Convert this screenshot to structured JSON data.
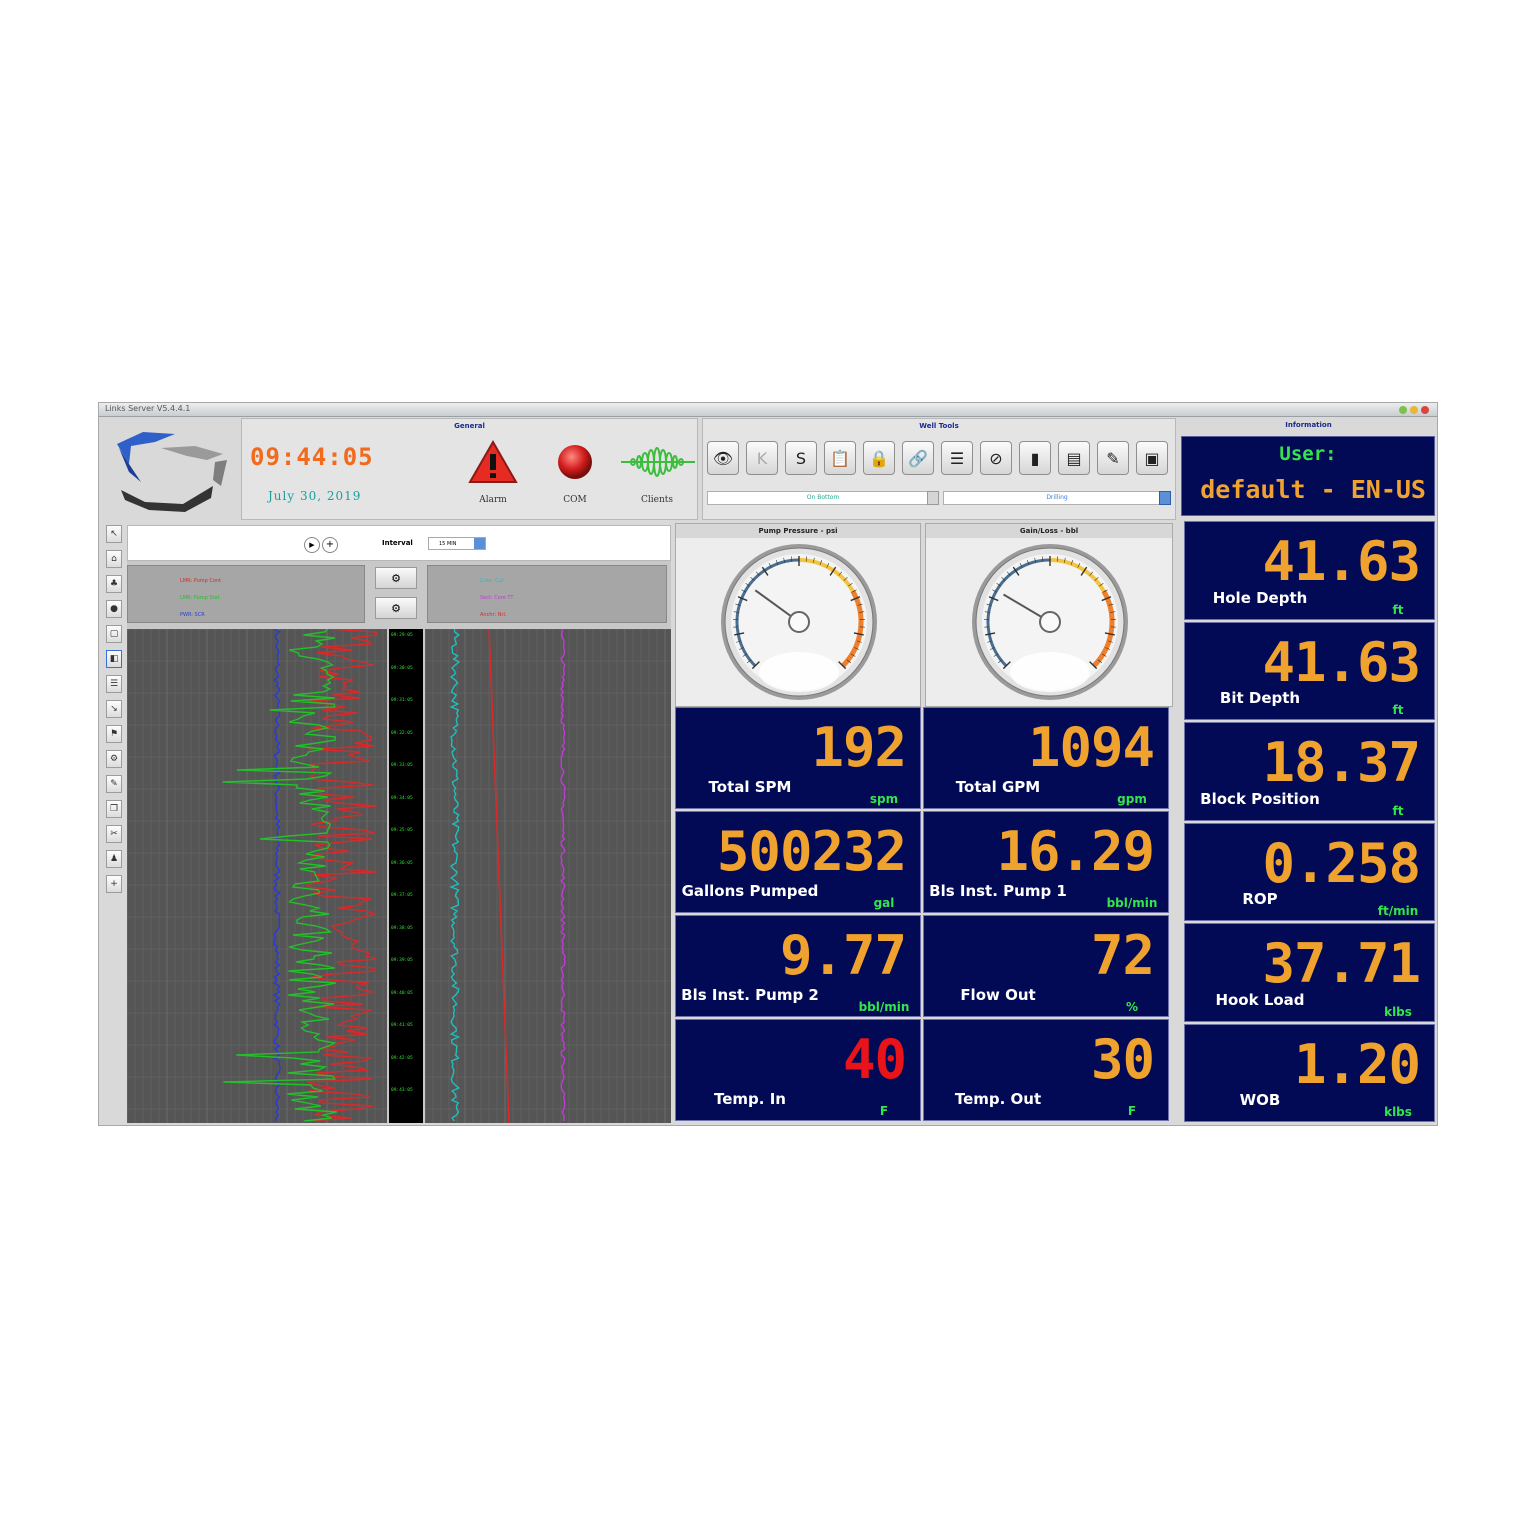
{
  "window": {
    "title": "Links Server V5.4.4.1"
  },
  "general": {
    "section_title": "General",
    "clock": "09:44:05",
    "date": "July 30, 2019",
    "alarm_label": "Alarm",
    "com_label": "COM",
    "clients_label": "Clients"
  },
  "well_tools": {
    "section_title": "Well Tools",
    "buttons": [
      "eye-icon",
      "k-icon",
      "s-icon",
      "clipboard-icon",
      "lock-icon",
      "link-icon",
      "list-icon",
      "compass-icon",
      "tablet-icon",
      "panel-icon",
      "edit-icon",
      "box-icon"
    ],
    "rig_state": "On Bottom",
    "activity": "Drilling"
  },
  "information": {
    "section_title": "Information",
    "user_label": "User:",
    "user_value": "default - EN-US"
  },
  "chart_controls": {
    "interval_label": "Interval",
    "interval_value": "15 MIN"
  },
  "legend_left": [
    {
      "name": "LMR: Pump Cont.",
      "color": "#d82a2a"
    },
    {
      "name": "LMR: Pump Stat.",
      "color": "#22c12a"
    },
    {
      "name": "PWR: SCR",
      "color": "#2a3ad8"
    }
  ],
  "legend_right": [
    {
      "name": "Cute: Cut.",
      "color": "#1ebfbf"
    },
    {
      "name": "Sect: Core TT",
      "color": "#c23ad8"
    },
    {
      "name": "Anchr: Nrl.",
      "color": "#d82a2a"
    }
  ],
  "time_ticks": [
    "09:29:05",
    "09:30:05",
    "09:31:05",
    "09:32:05",
    "09:33:05",
    "09:34:05",
    "09:35:05",
    "09:36:05",
    "09:37:05",
    "09:38:05",
    "09:39:05",
    "09:40:05",
    "09:41:05",
    "09:42:05",
    "09:43:05"
  ],
  "gauges": [
    {
      "title": "Pump Pressure - psi",
      "needle_fraction": 0.3
    },
    {
      "title": "Gain/Loss - bbl",
      "needle_fraction": 0.28
    }
  ],
  "tiles_mid": [
    {
      "label": "Total SPM",
      "value": "192",
      "unit": "spm",
      "value_color": "#f0a22e"
    },
    {
      "label": "Total GPM",
      "value": "1094",
      "unit": "gpm",
      "value_color": "#f0a22e"
    },
    {
      "label": "Gallons Pumped",
      "value": "500232",
      "unit": "gal",
      "value_color": "#f0a22e"
    },
    {
      "label": "Bls Inst. Pump 1",
      "value": "16.29",
      "unit": "bbl/min",
      "value_color": "#f0a22e"
    },
    {
      "label": "Bls Inst. Pump 2",
      "value": "9.77",
      "unit": "bbl/min",
      "value_color": "#f0a22e"
    },
    {
      "label": "Flow Out",
      "value": "72",
      "unit": "%",
      "value_color": "#f0a22e"
    },
    {
      "label": "Temp. In",
      "value": "40",
      "unit": "F",
      "value_color": "#e8141a"
    },
    {
      "label": "Temp. Out",
      "value": "30",
      "unit": "F",
      "value_color": "#f0a22e"
    }
  ],
  "tiles_right": [
    {
      "label": "Hole Depth",
      "value": "41.63",
      "unit": "ft"
    },
    {
      "label": "Bit Depth",
      "value": "41.63",
      "unit": "ft"
    },
    {
      "label": "Block Position",
      "value": "18.37",
      "unit": "ft"
    },
    {
      "label": "ROP",
      "value": "0.258",
      "unit": "ft/min"
    },
    {
      "label": "Hook Load",
      "value": "37.71",
      "unit": "klbs"
    },
    {
      "label": "WOB",
      "value": "1.20",
      "unit": "klbs"
    }
  ],
  "colors": {
    "panel_bg": "#030a55",
    "value_orange": "#f0a22e",
    "unit_green": "#32e64a",
    "clock_orange": "#f26a1b"
  }
}
